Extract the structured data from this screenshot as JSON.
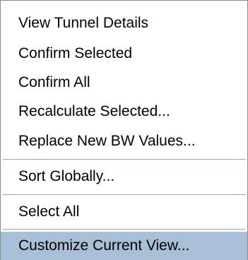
{
  "context_menu": {
    "items": [
      {
        "label": "View Tunnel Details"
      },
      {
        "label": "Confirm Selected"
      },
      {
        "label": "Confirm All"
      },
      {
        "label": "Recalculate Selected..."
      },
      {
        "label": "Replace New BW Values..."
      },
      {
        "label": "Sort Globally..."
      },
      {
        "label": "Select All"
      },
      {
        "label": "Customize Current View..."
      }
    ],
    "highlighted_item": "Customize Current View...",
    "colors": {
      "background": "#ffffff",
      "highlight": "#a9bfd7",
      "separator": "#8ea4be",
      "border": "#8a8a8a",
      "text": "#000000"
    }
  }
}
